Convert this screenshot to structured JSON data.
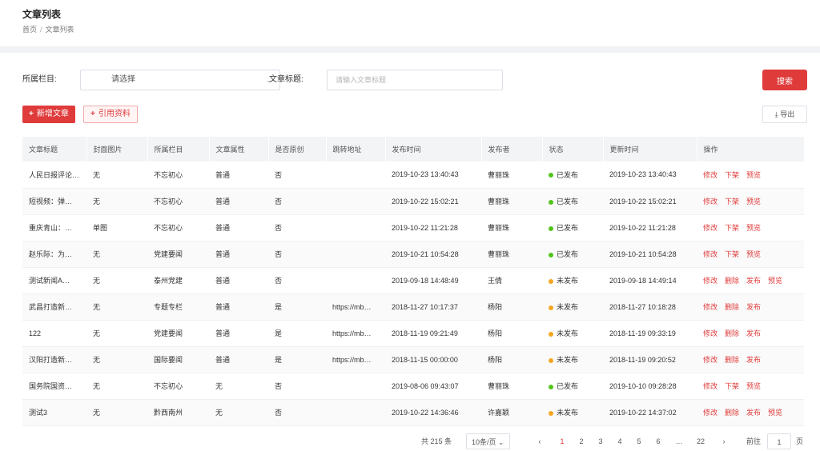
{
  "header": {
    "title": "文章列表",
    "breadcrumb": [
      "首页",
      "文章列表"
    ]
  },
  "filters": {
    "column_label": "所属栏目:",
    "column_value": "请选择",
    "title_label": "文章标题:",
    "title_placeholder": "请输入文章标题",
    "search_label": "搜索"
  },
  "actions": {
    "add_label": "新增文章",
    "import_label": "引用资料",
    "export_label": "导出"
  },
  "table": {
    "columns": [
      "文章标题",
      "封面图片",
      "所属栏目",
      "文章属性",
      "是否原创",
      "跳转地址",
      "发布时间",
      "发布者",
      "状态",
      "更新时间",
      "操作"
    ],
    "rows": [
      {
        "title": "人民日报评论…",
        "cover": "无",
        "column": "不忘初心",
        "attr": "普通",
        "original": "否",
        "link": "",
        "pub": "2019-10-23 13:40:43",
        "author": "曹丽珠",
        "status": "已发布",
        "status_color": "#52c41a",
        "upd": "2019-10-23 13:40:43",
        "ops": [
          "修改",
          "下架",
          "预览"
        ]
      },
      {
        "title": "短视频：弹…",
        "cover": "无",
        "column": "不忘初心",
        "attr": "普通",
        "original": "否",
        "link": "",
        "pub": "2019-10-22 15:02:21",
        "author": "曹丽珠",
        "status": "已发布",
        "status_color": "#52c41a",
        "upd": "2019-10-22 15:02:21",
        "ops": [
          "修改",
          "下架",
          "预览"
        ]
      },
      {
        "title": "重庆青山：…",
        "cover": "单图",
        "column": "不忘初心",
        "attr": "普通",
        "original": "否",
        "link": "",
        "pub": "2019-10-22 11:21:28",
        "author": "曹丽珠",
        "status": "已发布",
        "status_color": "#52c41a",
        "upd": "2019-10-22 11:21:28",
        "ops": [
          "修改",
          "下架",
          "预览"
        ]
      },
      {
        "title": "赵乐际：为…",
        "cover": "无",
        "column": "党建要闻",
        "attr": "普通",
        "original": "否",
        "link": "",
        "pub": "2019-10-21 10:54:28",
        "author": "曹丽珠",
        "status": "已发布",
        "status_color": "#52c41a",
        "upd": "2019-10-21 10:54:28",
        "ops": [
          "修改",
          "下架",
          "预览"
        ]
      },
      {
        "title": "测试新闻A…",
        "cover": "无",
        "column": "泰州党建",
        "attr": "普通",
        "original": "否",
        "link": "",
        "pub": "2019-09-18 14:48:49",
        "author": "王倩",
        "status": "未发布",
        "status_color": "#f5a623",
        "upd": "2019-09-18 14:49:14",
        "ops": [
          "修改",
          "删除",
          "发布",
          "预览"
        ]
      },
      {
        "title": "武昌打造新…",
        "cover": "无",
        "column": "专题专栏",
        "attr": "普通",
        "original": "是",
        "link": "https://mb…",
        "pub": "2018-11-27 10:17:37",
        "author": "杨阳",
        "status": "未发布",
        "status_color": "#f5a623",
        "upd": "2018-11-27 10:18:28",
        "ops": [
          "修改",
          "删除",
          "发布"
        ]
      },
      {
        "title": "122",
        "cover": "无",
        "column": "党建要闻",
        "attr": "普通",
        "original": "是",
        "link": "https://mb…",
        "pub": "2018-11-19 09:21:49",
        "author": "杨阳",
        "status": "未发布",
        "status_color": "#f5a623",
        "upd": "2018-11-19 09:33:19",
        "ops": [
          "修改",
          "删除",
          "发布"
        ]
      },
      {
        "title": "汉阳打造新…",
        "cover": "无",
        "column": "国际要闻",
        "attr": "普通",
        "original": "是",
        "link": "https://mb…",
        "pub": "2018-11-15 00:00:00",
        "author": "杨阳",
        "status": "未发布",
        "status_color": "#f5a623",
        "upd": "2018-11-19 09:20:52",
        "ops": [
          "修改",
          "删除",
          "发布"
        ]
      },
      {
        "title": "国务院国资…",
        "cover": "无",
        "column": "不忘初心",
        "attr": "无",
        "original": "否",
        "link": "",
        "pub": "2019-08-06 09:43:07",
        "author": "曹丽珠",
        "status": "已发布",
        "status_color": "#52c41a",
        "upd": "2019-10-10 09:28:28",
        "ops": [
          "修改",
          "下架",
          "预览"
        ]
      },
      {
        "title": "测试3",
        "cover": "无",
        "column": "黔西南州",
        "attr": "无",
        "original": "否",
        "link": "",
        "pub": "2019-10-22 14:36:46",
        "author": "许嘉颖",
        "status": "未发布",
        "status_color": "#f5a623",
        "upd": "2019-10-22 14:37:02",
        "ops": [
          "修改",
          "删除",
          "发布",
          "预览"
        ]
      }
    ]
  },
  "pagination": {
    "total": "共 215 条",
    "page_size": "10条/页",
    "prev": "‹",
    "pages": [
      "1",
      "2",
      "3",
      "4",
      "5",
      "6"
    ],
    "ellipsis": "…",
    "last": "22",
    "next": "›",
    "goto_label": "前往",
    "goto_value": "1",
    "goto_unit": "页"
  }
}
